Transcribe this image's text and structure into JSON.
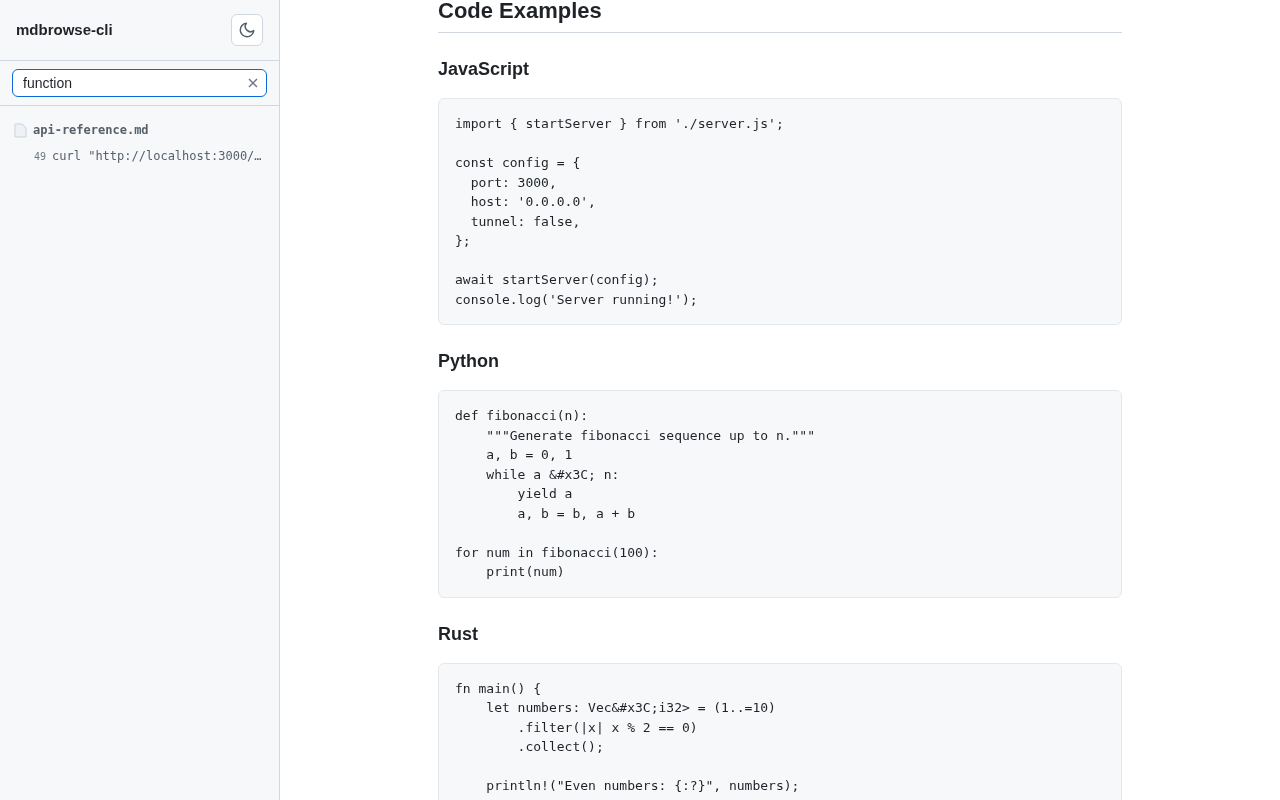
{
  "sidebar": {
    "title": "mdbrowse-cli",
    "theme_button": {
      "kind": "dark-mode"
    },
    "search": {
      "value": "function"
    },
    "results": [
      {
        "file": "api-reference.md",
        "matches": [
          {
            "line": "49",
            "text": "curl \"http://localhost:3000/…"
          }
        ]
      }
    ]
  },
  "content": {
    "heading": "Code Examples",
    "sections": [
      {
        "title": "JavaScript",
        "code": "import { startServer } from './server.js';\n\nconst config = {\n  port: 3000,\n  host: '0.0.0.0',\n  tunnel: false,\n};\n\nawait startServer(config);\nconsole.log('Server running!');"
      },
      {
        "title": "Python",
        "code": "def fibonacci(n):\n    \"\"\"Generate fibonacci sequence up to n.\"\"\"\n    a, b = 0, 1\n    while a &#x3C; n:\n        yield a\n        a, b = b, a + b\n\nfor num in fibonacci(100):\n    print(num)"
      },
      {
        "title": "Rust",
        "code": "fn main() {\n    let numbers: Vec&#x3C;i32> = (1..=10)\n        .filter(|x| x % 2 == 0)\n        .collect();\n\n    println!(\"Even numbers: {:?}\", numbers);"
      }
    ]
  }
}
